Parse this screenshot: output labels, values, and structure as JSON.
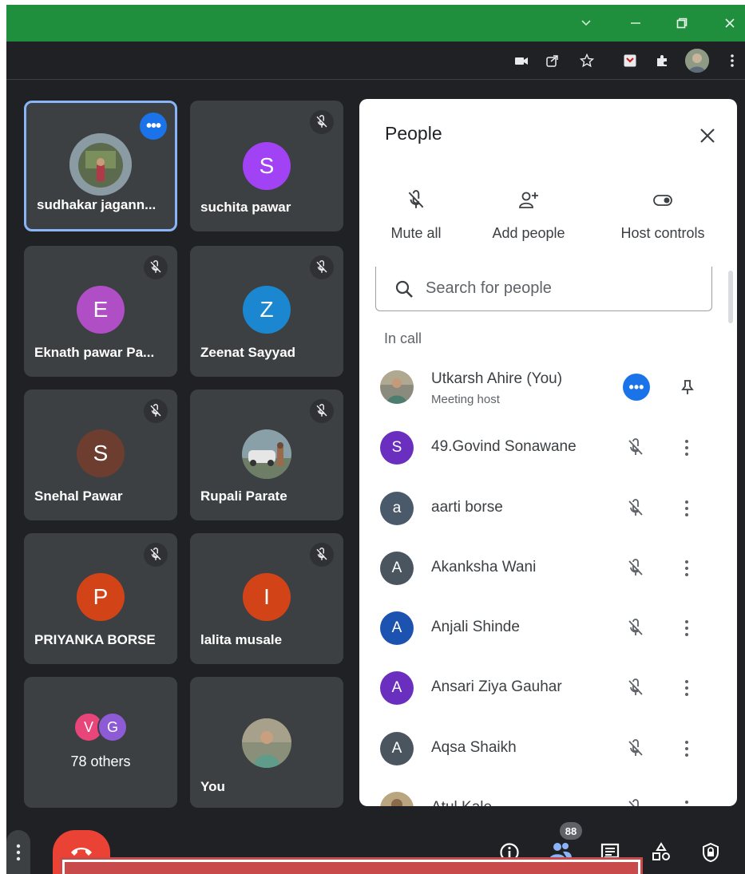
{
  "window": {
    "controls": [
      "chevron-down-icon",
      "minimize-icon",
      "restore-icon",
      "close-icon"
    ]
  },
  "browser_toolbar": {
    "icons": [
      "camera-icon",
      "share-icon",
      "star-icon",
      "extension-app-icon",
      "puzzle-icon",
      "profile-avatar",
      "menu-kebab-icon"
    ]
  },
  "tiles": [
    {
      "name": "sudhakar jagann...",
      "type": "photo",
      "active": true
    },
    {
      "name": "suchita pawar",
      "initial": "S",
      "color": "#a142f4"
    },
    {
      "name": "Eknath pawar Pa...",
      "initial": "E",
      "color": "#b04fc5"
    },
    {
      "name": "Zeenat Sayyad",
      "initial": "Z",
      "color": "#1a87d0"
    },
    {
      "name": "Snehal Pawar",
      "initial": "S",
      "color": "#6d3e2f"
    },
    {
      "name": "Rupali Parate",
      "type": "photo"
    },
    {
      "name": "PRIYANKA BORSE",
      "initial": "P",
      "color": "#d24417"
    },
    {
      "name": "lalita musale",
      "initial": "I",
      "color": "#d24417"
    },
    {
      "others_label": "78 others",
      "bubbles": [
        {
          "initial": "V",
          "color": "#e8457a"
        },
        {
          "initial": "G",
          "color": "#8e5bd6"
        }
      ]
    },
    {
      "name": "You",
      "type": "photo"
    }
  ],
  "panel": {
    "title": "People",
    "actions": {
      "mute_all": "Mute all",
      "add_people": "Add people",
      "host_controls": "Host controls"
    },
    "search": {
      "placeholder": "Search for people",
      "value": ""
    },
    "section": "In call",
    "people": [
      {
        "name": "Utkarsh Ahire (You)",
        "subtitle": "Meeting host",
        "avatar": "photo"
      },
      {
        "name": "49.Govind Sonawane",
        "initial": "S",
        "color": "#6a2fbf"
      },
      {
        "name": "aarti borse",
        "initial": "a",
        "color": "#4a5a6a"
      },
      {
        "name": "Akanksha Wani",
        "initial": "A",
        "color": "#4a5560"
      },
      {
        "name": "Anjali Shinde",
        "initial": "A",
        "color": "#1d53b0"
      },
      {
        "name": "Ansari Ziya Gauhar",
        "initial": "A",
        "color": "#6a2fbf"
      },
      {
        "name": "Aqsa Shaikh",
        "initial": "A",
        "color": "#4a5560"
      },
      {
        "name": "Atul Kale",
        "avatar": "photo"
      }
    ]
  },
  "bottom_bar": {
    "participant_count": "88",
    "icons": [
      "more-options-icon",
      "end-call-icon",
      "info-icon",
      "people-icon",
      "chat-icon",
      "activities-icon",
      "host-lock-icon"
    ]
  },
  "colors": {
    "titlebar": "#1f8e3d",
    "background": "#202124",
    "tile": "#3c4043",
    "accent": "#1a73e8",
    "end_call": "#ea4335"
  }
}
